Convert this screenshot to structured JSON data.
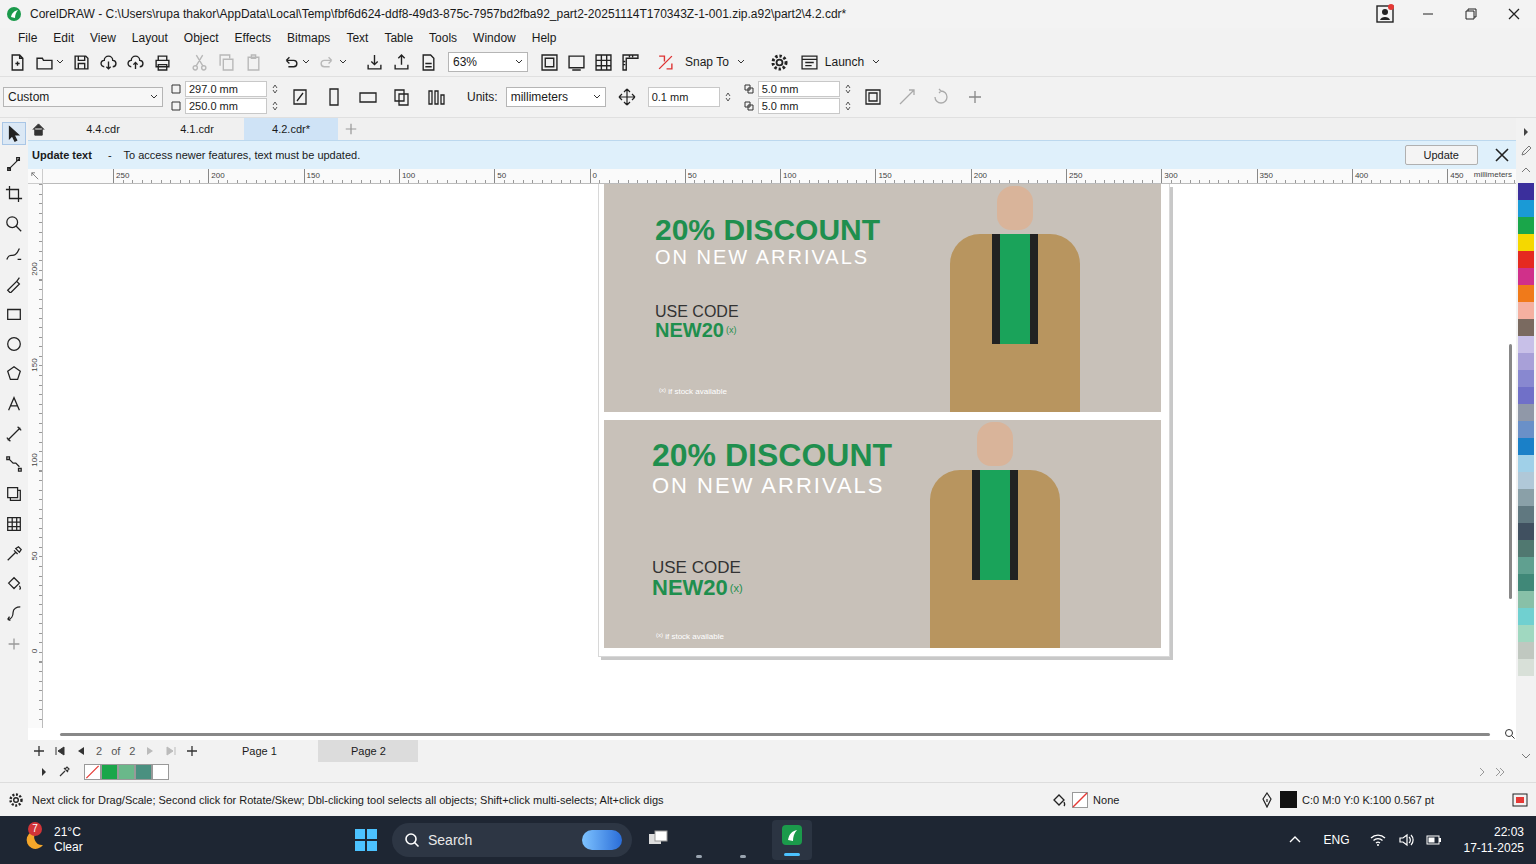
{
  "window": {
    "title": "CorelDRAW - C:\\Users\\rupa thakor\\AppData\\Local\\Temp\\fbf6d624-ddf8-49d3-875c-7957bd2fba92_part2-20251114T170343Z-1-001.zip.a92\\part2\\4.2.cdr*"
  },
  "menu": [
    "File",
    "Edit",
    "View",
    "Layout",
    "Object",
    "Effects",
    "Bitmaps",
    "Text",
    "Table",
    "Tools",
    "Window",
    "Help"
  ],
  "standard_toolbar": {
    "buttons": [
      {
        "disabled": false
      },
      {
        "disabled": false
      },
      {
        "disabled": false
      },
      {
        "disabled": false
      },
      {
        "disabled": false
      },
      {
        "disabled": false
      },
      {
        "disabled": true
      },
      {
        "disabled": true
      },
      {
        "disabled": true
      },
      {
        "disabled": false
      },
      {
        "disabled": true
      },
      {
        "disabled": false
      },
      {
        "disabled": false
      },
      {
        "disabled": false
      }
    ],
    "zoom": "63%",
    "snap": "Snap To",
    "launch": "Launch"
  },
  "property_bar": {
    "preset": "Custom",
    "width": "297.0 mm",
    "height": "250.0 mm",
    "units_label": "Units:",
    "units": "millimeters",
    "nudge": "0.1 mm",
    "duplicate_x": "5.0 mm",
    "duplicate_y": "5.0 mm"
  },
  "doc_tabs": [
    {
      "label": "4.4.cdr",
      "selected": false
    },
    {
      "label": "4.1.cdr",
      "selected": false
    },
    {
      "label": "4.2.cdr*",
      "selected": true
    }
  ],
  "notification": {
    "title": "Update text",
    "separator": "-",
    "message": "To access newer features, text must be updated.",
    "button": "Update"
  },
  "rulers": {
    "horizontal": [
      "250",
      "200",
      "150",
      "100",
      "50",
      "0",
      "50",
      "100",
      "150",
      "200",
      "250",
      "300",
      "350",
      "400",
      "450"
    ],
    "unit": "millimeters",
    "vertical": [
      "200",
      "150",
      "100",
      "50",
      "0"
    ]
  },
  "toolbox": [
    {
      "selected": true
    },
    {
      "selected": false
    },
    {
      "selected": false
    },
    {
      "selected": false
    },
    {
      "selected": false
    },
    {
      "selected": false
    },
    {
      "selected": false
    },
    {
      "selected": false
    },
    {
      "selected": false
    },
    {
      "selected": false
    },
    {
      "selected": false
    },
    {
      "selected": false
    },
    {
      "selected": false
    },
    {
      "selected": false
    },
    {
      "selected": false
    },
    {
      "selected": false
    },
    {
      "selected": false
    },
    {
      "selected": false
    }
  ],
  "document": {
    "banners": [
      {
        "kind": "compact",
        "headline": "20% DISCOUNT",
        "subline": "ON NEW ARRIVALS",
        "code_label": "USE CODE",
        "code": "NEW20",
        "mark": "(x)",
        "footnote_mark": "(x)",
        "footnote": "if stock available"
      },
      {
        "kind": "large",
        "headline": "20% DISCOUNT",
        "subline": "ON NEW ARRIVALS",
        "code_label": "USE CODE",
        "code": "NEW20",
        "mark": "(x)",
        "footnote_mark": "(x)",
        "footnote": "if stock available"
      }
    ]
  },
  "page_nav": {
    "current": "2",
    "of": "of",
    "total": "2",
    "pages": [
      {
        "label": "Page 1",
        "selected": false
      },
      {
        "label": "Page 2",
        "selected": true
      }
    ]
  },
  "document_palette": [
    {
      "kind": "none",
      "color": "#ffffff"
    },
    {
      "kind": "color",
      "color": "#1aa64a"
    },
    {
      "kind": "color",
      "color": "#6ab88a"
    },
    {
      "kind": "color",
      "color": "#4a9080"
    },
    {
      "kind": "color",
      "color": "#ffffff"
    }
  ],
  "color_palette": [
    {
      "color": "#3b2f9c"
    },
    {
      "color": "#1a9ad6"
    },
    {
      "color": "#1aa64a"
    },
    {
      "color": "#f5d800"
    },
    {
      "color": "#e52a20"
    },
    {
      "color": "#d0308a"
    },
    {
      "color": "#f07a1a"
    },
    {
      "color": "#f5b0a0"
    },
    {
      "color": "#7a6a60"
    },
    {
      "color": "#c8c0e8"
    },
    {
      "color": "#a8a0d8"
    },
    {
      "color": "#8888d0"
    },
    {
      "color": "#7070c8"
    },
    {
      "color": "#9098a8"
    },
    {
      "color": "#6a90c8"
    },
    {
      "color": "#1a80c8"
    },
    {
      "color": "#a0d0e8"
    },
    {
      "color": "#b0c8d8"
    },
    {
      "color": "#8aa0a8"
    },
    {
      "color": "#607880"
    },
    {
      "color": "#405060"
    },
    {
      "color": "#507870"
    },
    {
      "color": "#60a090"
    },
    {
      "color": "#408878"
    },
    {
      "color": "#88c0a8"
    },
    {
      "color": "#70d0d0"
    },
    {
      "color": "#a0d8c0"
    },
    {
      "color": "#c0c8c0"
    },
    {
      "color": "#d8e0d8"
    }
  ],
  "status_bar": {
    "hint": "Next click for Drag/Scale; Second click for Rotate/Skew; Dbl-clicking tool selects all objects; Shift+click multi-selects; Alt+click digs",
    "fill": "None",
    "outline": "C:0 M:0 Y:0 K:100 0.567 pt"
  },
  "taskbar": {
    "temperature": "21°C",
    "weather": "Clear",
    "badge": "7",
    "search": "Search",
    "language": "ENG",
    "time": "22:03",
    "date": "17-11-2025"
  }
}
